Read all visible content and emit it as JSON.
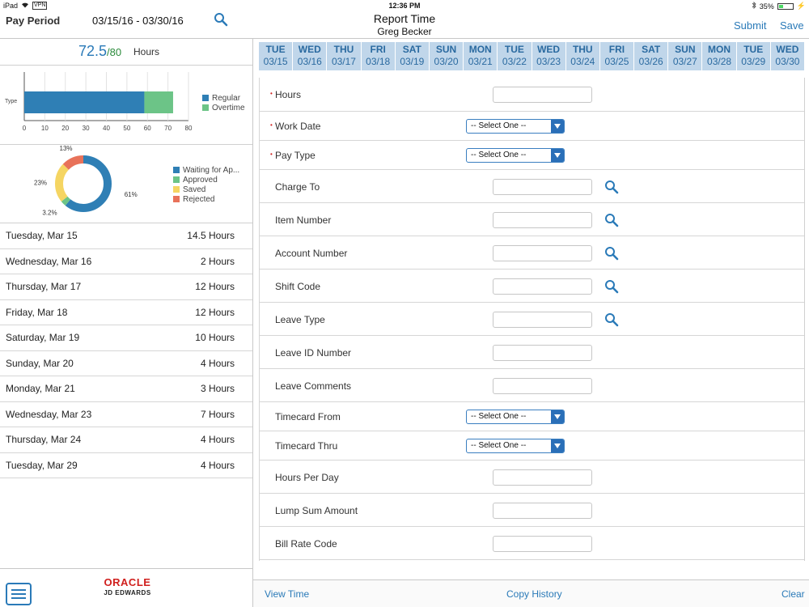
{
  "status_bar": {
    "device": "iPad",
    "vpn": "VPN",
    "time": "12:36 PM",
    "battery": "35%",
    "battery_level": 0.35
  },
  "header": {
    "pay_period_label": "Pay Period",
    "date_range": "03/15/16 - 03/30/16",
    "title": "Report Time",
    "subtitle": "Greg Becker",
    "submit_label": "Submit",
    "save_label": "Save"
  },
  "summary": {
    "hours": "72.5",
    "max_hours": "/80",
    "hours_label": "Hours"
  },
  "chart_data": [
    {
      "type": "bar",
      "orientation": "horizontal",
      "stacked": true,
      "categories": [
        "Type"
      ],
      "series": [
        {
          "name": "Regular",
          "values": [
            58.5
          ],
          "color": "#2f7fb5"
        },
        {
          "name": "Overtime",
          "values": [
            14
          ],
          "color": "#6cc487"
        }
      ],
      "xlim": [
        0,
        80
      ],
      "xticks": [
        "0",
        "10",
        "20",
        "30",
        "40",
        "50",
        "60",
        "70",
        "80"
      ],
      "legend": "right",
      "grid": true
    },
    {
      "type": "pie",
      "donut": true,
      "categories": [
        "Waiting for Ap...",
        "Approved",
        "Saved",
        "Rejected"
      ],
      "values": [
        61,
        3.2,
        23,
        13
      ],
      "labels": [
        "61%",
        "3.2%",
        "23%",
        "13%"
      ],
      "colors": [
        "#2f7fb5",
        "#6cc487",
        "#f5d562",
        "#e8725a"
      ],
      "legend": "right"
    }
  ],
  "days": [
    {
      "day": "Tuesday, Mar 15",
      "hours": "14.5 Hours"
    },
    {
      "day": "Wednesday, Mar 16",
      "hours": "2 Hours"
    },
    {
      "day": "Thursday, Mar 17",
      "hours": "12 Hours"
    },
    {
      "day": "Friday, Mar 18",
      "hours": "12 Hours"
    },
    {
      "day": "Saturday, Mar 19",
      "hours": "10 Hours"
    },
    {
      "day": "Sunday, Mar 20",
      "hours": "4 Hours"
    },
    {
      "day": "Monday, Mar 21",
      "hours": "3 Hours"
    },
    {
      "day": "Wednesday, Mar 23",
      "hours": "7 Hours"
    },
    {
      "day": "Thursday, Mar 24",
      "hours": "4 Hours"
    },
    {
      "day": "Tuesday, Mar 29",
      "hours": "4 Hours"
    }
  ],
  "branding": {
    "oracle": "ORACLE",
    "product": "JD EDWARDS"
  },
  "date_strip": [
    {
      "dow": "TUE",
      "date": "03/15"
    },
    {
      "dow": "WED",
      "date": "03/16"
    },
    {
      "dow": "THU",
      "date": "03/17"
    },
    {
      "dow": "FRI",
      "date": "03/18"
    },
    {
      "dow": "SAT",
      "date": "03/19"
    },
    {
      "dow": "SUN",
      "date": "03/20"
    },
    {
      "dow": "MON",
      "date": "03/21"
    },
    {
      "dow": "TUE",
      "date": "03/22"
    },
    {
      "dow": "WED",
      "date": "03/23"
    },
    {
      "dow": "THU",
      "date": "03/24"
    },
    {
      "dow": "FRI",
      "date": "03/25"
    },
    {
      "dow": "SAT",
      "date": "03/26"
    },
    {
      "dow": "SUN",
      "date": "03/27"
    },
    {
      "dow": "MON",
      "date": "03/28"
    },
    {
      "dow": "TUE",
      "date": "03/29"
    },
    {
      "dow": "WED",
      "date": "03/30"
    }
  ],
  "form": {
    "select_placeholder": "-- Select One --",
    "fields": [
      {
        "label": "Hours",
        "kind": "text",
        "required": true,
        "lookup": false
      },
      {
        "label": "Work Date",
        "kind": "select",
        "required": true,
        "lookup": false
      },
      {
        "label": "Pay Type",
        "kind": "select",
        "required": true,
        "lookup": false
      },
      {
        "label": "Charge To",
        "kind": "text",
        "required": false,
        "lookup": true
      },
      {
        "label": "Item Number",
        "kind": "text",
        "required": false,
        "lookup": true
      },
      {
        "label": "Account Number",
        "kind": "text",
        "required": false,
        "lookup": true
      },
      {
        "label": "Shift Code",
        "kind": "text",
        "required": false,
        "lookup": true
      },
      {
        "label": "Leave Type",
        "kind": "text",
        "required": false,
        "lookup": true
      },
      {
        "label": "Leave ID Number",
        "kind": "text",
        "required": false,
        "lookup": false
      },
      {
        "label": "Leave Comments",
        "kind": "text",
        "required": false,
        "lookup": false
      },
      {
        "label": "Timecard From",
        "kind": "select",
        "required": false,
        "lookup": false
      },
      {
        "label": "Timecard Thru",
        "kind": "select",
        "required": false,
        "lookup": false
      },
      {
        "label": "Hours Per Day",
        "kind": "text",
        "required": false,
        "lookup": false
      },
      {
        "label": "Lump Sum Amount",
        "kind": "text",
        "required": false,
        "lookup": false
      },
      {
        "label": "Bill Rate Code",
        "kind": "text",
        "required": false,
        "lookup": false
      }
    ]
  },
  "footer": {
    "view_time": "View Time",
    "copy_history": "Copy History",
    "clear": "Clear"
  },
  "colors": {
    "accent": "#2a7ab8",
    "date_cell_bg": "#c0d6ea",
    "required_marker": "#d0201e",
    "oracle_red": "#d0201e"
  },
  "icons": {
    "header_search": "search-icon",
    "lookup": "search-icon",
    "menu": "menu-icon",
    "bluetooth": "bluetooth-icon",
    "wifi": "wifi-icon",
    "battery": "battery-icon"
  }
}
